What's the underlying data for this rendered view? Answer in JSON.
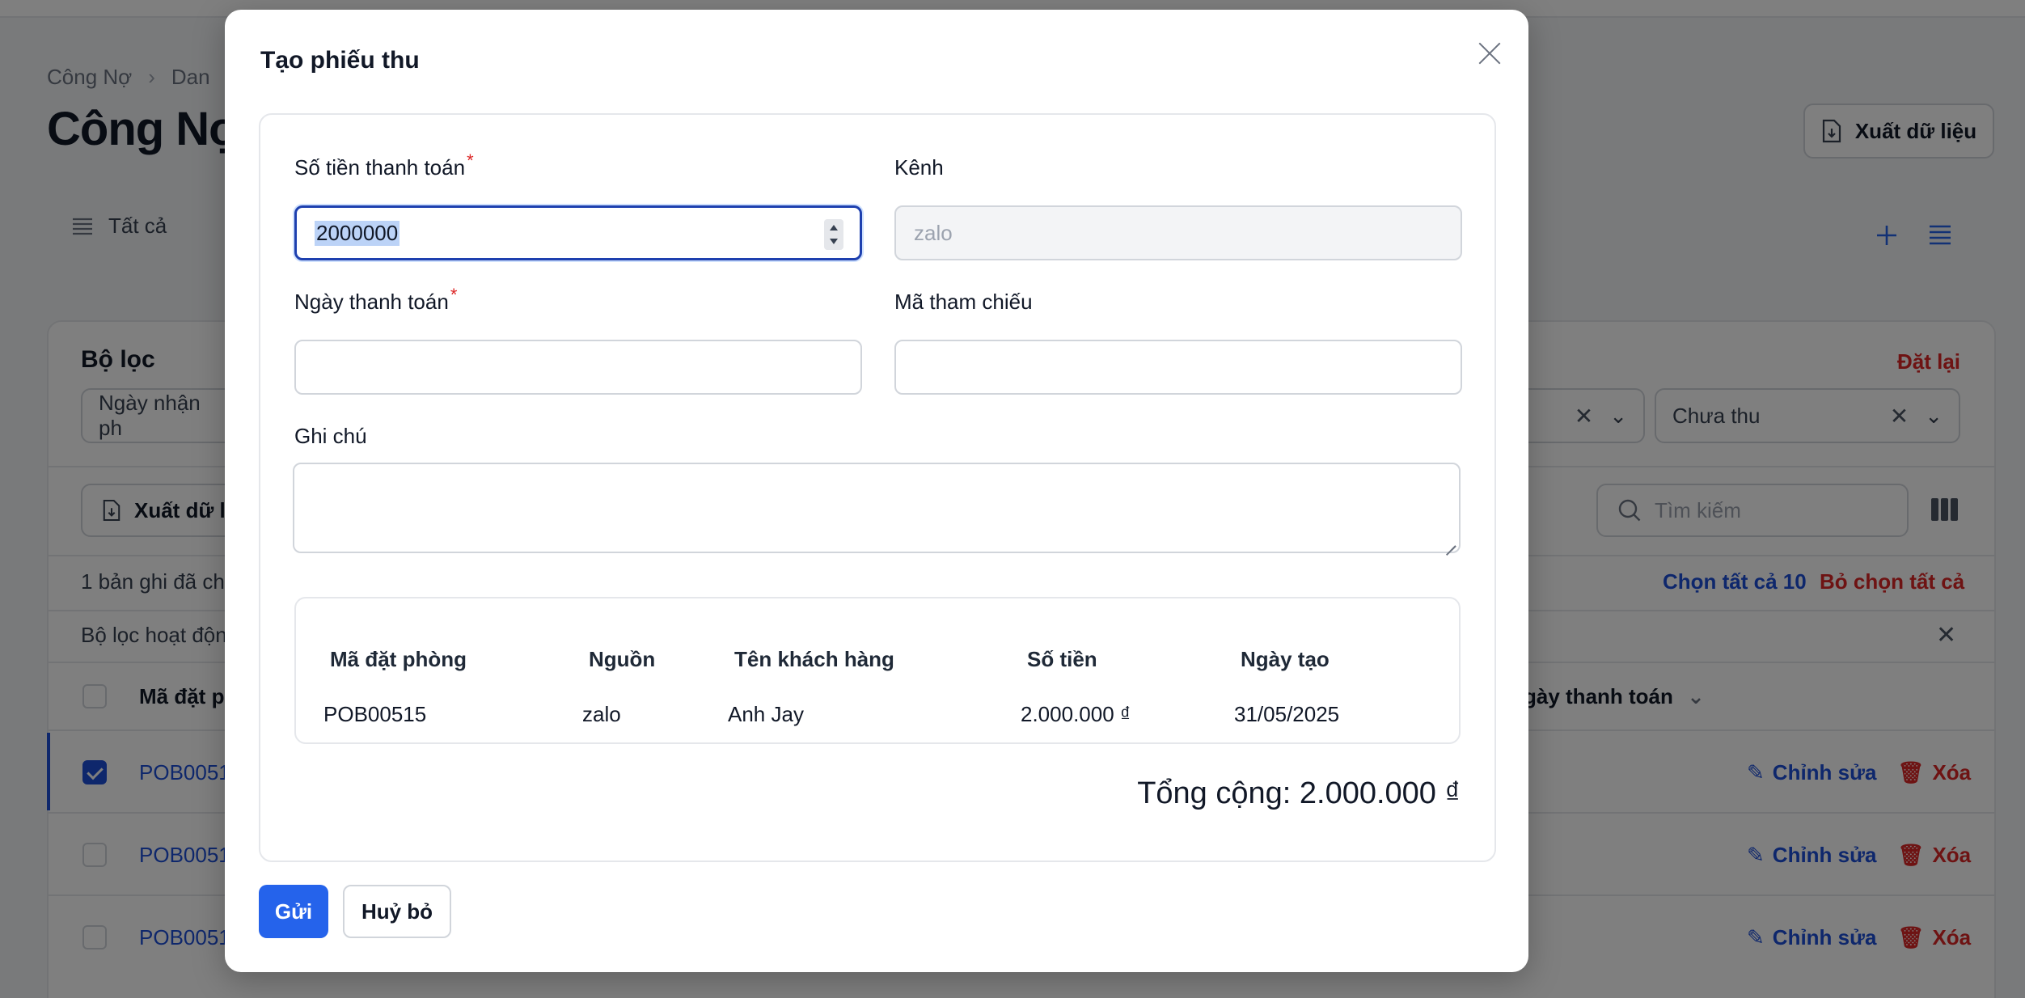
{
  "background": {
    "breadcrumb": [
      "Công Nợ",
      "Dan"
    ],
    "page_title": "Công Nợ",
    "export_label": "Xuất dữ liệu",
    "tab_all_label": "Tất cả",
    "filter_title": "Bộ lọc",
    "reset_label": "Đặt lại",
    "filter_date_label": "Ngày nhận ph",
    "filter_status_value": "Chưa thu",
    "export_small_label": "Xuất dữ li",
    "search_placeholder": "Tìm kiếm",
    "selected_info": "1 bản ghi đã ch",
    "select_all_label": "Chọn tất cả 10",
    "deselect_all_label": "Bỏ chọn tất cả",
    "active_filter_label": "Bộ lọc hoạt độn",
    "col_booking": "Mã đặt p",
    "col_pay_date": "gày thanh toán",
    "rows": [
      {
        "code": "POB0051",
        "checked": true
      },
      {
        "code": "POB0051",
        "checked": false
      },
      {
        "code": "POB0051",
        "checked": false
      }
    ],
    "edit_label": "Chỉnh sửa",
    "delete_label": "Xóa"
  },
  "modal": {
    "title": "Tạo phiếu thu",
    "amount_label": "Số tiền thanh toán",
    "amount_value": "2000000",
    "channel_label": "Kênh",
    "channel_placeholder": "zalo",
    "pay_date_label": "Ngày thanh toán",
    "ref_label": "Mã tham chiếu",
    "note_label": "Ghi chú",
    "required_mark": "*",
    "table": {
      "headers": [
        "Mã đặt phòng",
        "Nguồn",
        "Tên khách hàng",
        "Số tiền",
        "Ngày tạo"
      ],
      "row": [
        "POB00515",
        "zalo",
        "Anh Jay",
        "2.000.000 ₫",
        "31/05/2025"
      ]
    },
    "total": "Tổng cộng: 2.000.000 ₫",
    "submit_label": "Gửi",
    "cancel_label": "Huỷ bỏ"
  },
  "colors": {
    "primary": "#2563eb",
    "danger": "#dc2626",
    "link": "#1d4ed8"
  }
}
